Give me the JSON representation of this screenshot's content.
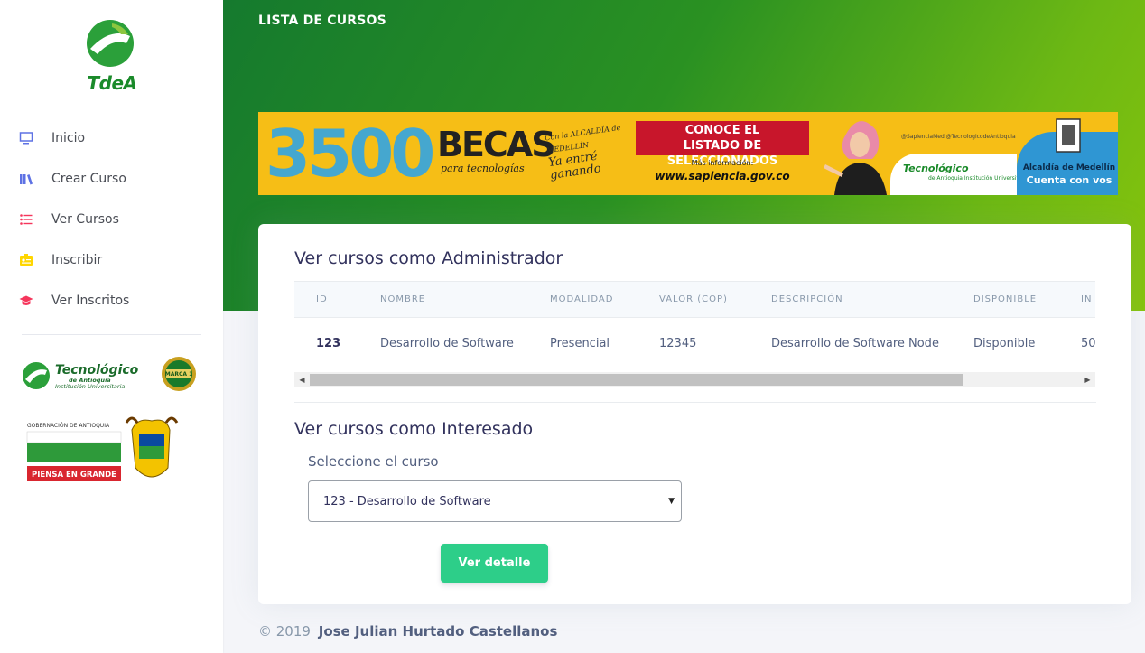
{
  "sidebar": {
    "brand": "TdeA",
    "items": [
      {
        "label": "Inicio",
        "icon": "monitor-icon"
      },
      {
        "label": "Crear Curso",
        "icon": "library-icon"
      },
      {
        "label": "Ver Cursos",
        "icon": "list-icon"
      },
      {
        "label": "Inscribir",
        "icon": "badge-icon"
      },
      {
        "label": "Ver Inscritos",
        "icon": "graduation-cap-icon"
      }
    ],
    "logo_tec": {
      "name": "Tecnológico",
      "line1": "de Antioquia",
      "line2": "Institución Universitaria",
      "seal": "MARCA 1"
    },
    "logo_gob": {
      "top": "GOBERNACIÓN DE ANTIOQUIA",
      "bottom": "PIENSA EN GRANDE"
    }
  },
  "header": {
    "title": "LISTA DE CURSOS"
  },
  "banner": {
    "number": "3500",
    "becas": "BECAS",
    "para": "para tecnologías",
    "alcaldia_small": "Con la ALCALDÍA de MEDELLÍN",
    "entre": "Ya entré ganando",
    "conoce": "CONOCE EL",
    "listado": "LISTADO DE SELECCIONADOS",
    "info": "Más información:",
    "url": "www.sapiencia.gov.co",
    "social": "@SapienciaMed   @TecnologicodeAntioquia",
    "tec": "Tecnológico",
    "tec_sub": "de Antioquia  Institución Universitaria",
    "alcaldia": "Alcaldía de Medellín",
    "cuenta": "Cuenta con vos"
  },
  "admin": {
    "title": "Ver cursos como Administrador",
    "columns": [
      "ID",
      "NOMBRE",
      "MODALIDAD",
      "VALOR (COP)",
      "DESCRIPCIÓN",
      "DISPONIBLE",
      "IN"
    ],
    "rows": [
      {
        "id": "123",
        "nombre": "Desarrollo de Software",
        "modalidad": "Presencial",
        "valor": "12345",
        "descripcion": "Desarrollo de Software Node",
        "disponible": "Disponible",
        "extra": "50"
      }
    ],
    "scroll_fraction": 0.0
  },
  "interesado": {
    "title": "Ver cursos como Interesado",
    "select_label": "Seleccione el curso",
    "selected": "123 - Desarrollo de Software",
    "button": "Ver detalle"
  },
  "footer": {
    "copyright": "© 2019",
    "author": "Jose Julian Hurtado Castellanos"
  },
  "colors": {
    "primary_green": "#2dce89",
    "header_start": "#157a2e",
    "header_end": "#86c40c",
    "banner_yellow": "#f6be16",
    "banner_red": "#c8162b"
  }
}
